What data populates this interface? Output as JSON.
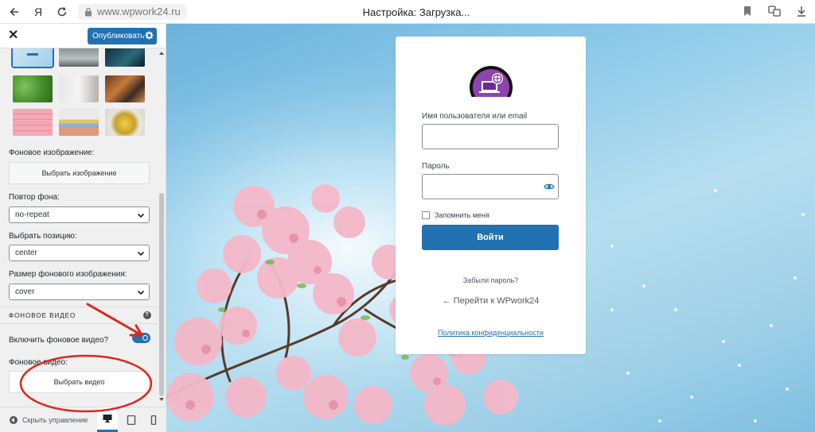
{
  "browser": {
    "url": "www.wpwork24.ru",
    "tab_title": "Настройка: Загрузка..."
  },
  "customizer": {
    "publish_label": "Опубликовать",
    "bg_image_label": "Фоновое изображение:",
    "select_image_btn": "Выбрать изображение",
    "repeat_label": "Повтор фона:",
    "repeat_value": "no-repeat",
    "position_label": "Выбрать позицию:",
    "position_value": "center",
    "size_label": "Размер фонового изображения:",
    "size_value": "cover",
    "video_section": "ФОНОВОЕ ВИДЕО",
    "enable_video_label": "Включить фоновое видео?",
    "enable_video_on": true,
    "bg_video_label": "Фоновое видео:",
    "select_video_btn": "Выбрать видео",
    "collapse_label": "Скрыть управление",
    "accent": "#2271b1"
  },
  "login": {
    "username_label": "Имя пользователя или email",
    "password_label": "Пароль",
    "remember_label": "Запомнить меня",
    "login_btn": "Войти",
    "lost_password": "Забыли пароль?",
    "back_link": "← Перейти к WPwork24",
    "privacy_link": "Политика конфиденциальности"
  }
}
